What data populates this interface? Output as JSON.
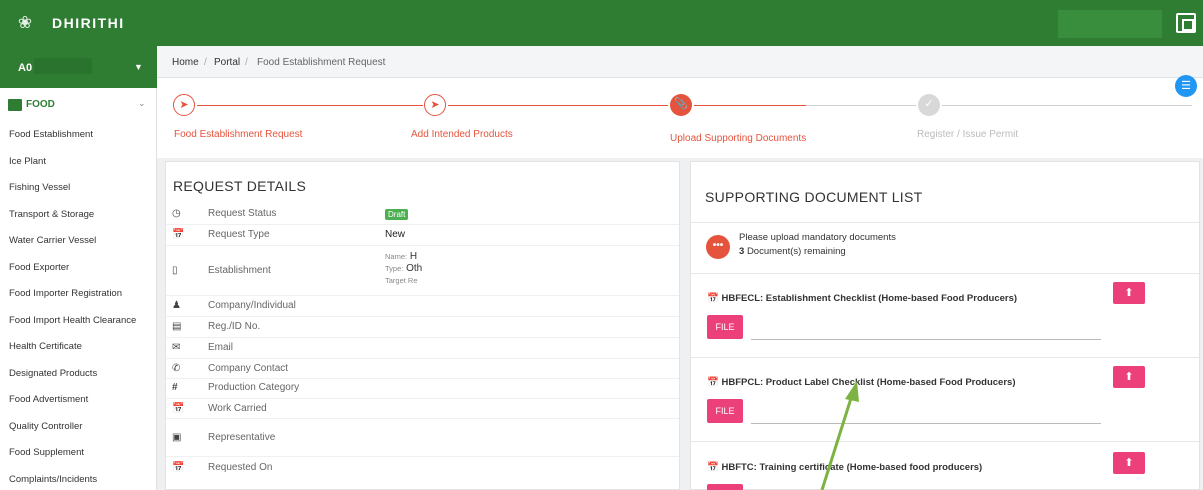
{
  "app": {
    "brand": "DHIRITHI",
    "user_prefix": "A0"
  },
  "icons": {
    "logo": "emblem-icon",
    "fullscreen": "fullscreen-icon",
    "menu": "list-icon"
  },
  "colors": {
    "topbar": "#2e7d32",
    "accent": "#e5533d",
    "upload": "#ec407a",
    "arrow": "#7cb342"
  },
  "sidebar": {
    "group_label": "FOOD",
    "items": [
      "Food Establishment",
      "Ice Plant",
      "Fishing Vessel",
      "Transport & Storage",
      "Water Carrier Vessel",
      "Food Exporter",
      "Food Importer Registration",
      "Food Import Health Clearance",
      "Health Certificate",
      "Designated Products",
      "Food Advertisment",
      "Quality Controller",
      "Food Supplement",
      "Complaints/Incidents"
    ]
  },
  "breadcrumb": {
    "home": "Home",
    "portal": "Portal",
    "current": "Food Establishment Request",
    "sep": "/"
  },
  "stepper": {
    "steps": [
      {
        "label": "Food Establishment Request",
        "state": "done"
      },
      {
        "label": "Add Intended Products",
        "state": "done"
      },
      {
        "label": "Upload Supporting Documents",
        "state": "active"
      },
      {
        "label": "Register / Issue Permit",
        "state": "todo"
      }
    ]
  },
  "request": {
    "title": "REQUEST DETAILS",
    "rows": {
      "status": {
        "label": "Request Status",
        "value": "Draft"
      },
      "type": {
        "label": "Request Type",
        "value": "New"
      },
      "establishment": {
        "label": "Establishment",
        "name_key": "Name:",
        "name_val": "H",
        "type_key": "Type:",
        "type_val": "Oth",
        "target_key": "Target Re"
      },
      "company": {
        "label": "Company/Individual"
      },
      "reg": {
        "label": "Reg./ID No."
      },
      "email": {
        "label": "Email"
      },
      "contact": {
        "label": "Company Contact"
      },
      "category": {
        "label": "Production Category"
      },
      "work": {
        "label": "Work Carried"
      },
      "rep": {
        "label": "Representative"
      },
      "requested": {
        "label": "Requested On"
      }
    }
  },
  "documents": {
    "title": "SUPPORTING DOCUMENT LIST",
    "info_line1": "Please upload mandatory documents",
    "remaining_count": "3",
    "remaining_text": "Document(s) remaining",
    "file_label": "FILE",
    "items": [
      {
        "name": "HBFECL: Establishment Checklist (Home-based Food Producers)"
      },
      {
        "name": "HBFPCL: Product Label Checklist (Home-based Food Producers)"
      },
      {
        "name": "HBFTC: Training certificate (Home-based food producers)"
      }
    ]
  }
}
